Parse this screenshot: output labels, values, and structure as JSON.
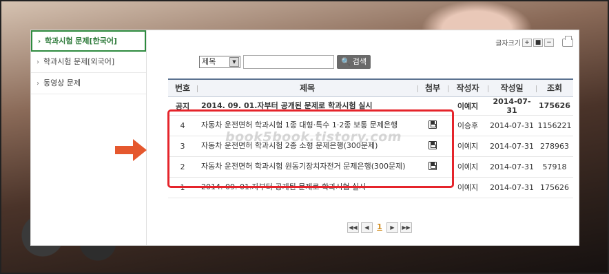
{
  "sidebar": {
    "items": [
      {
        "label": "학과시험 문제[한국어]",
        "active": true
      },
      {
        "label": "학과시험 문제[외국어]",
        "active": false
      },
      {
        "label": "동영상 문제",
        "active": false
      }
    ]
  },
  "font_size": {
    "label": "글자크기",
    "plus": "+",
    "reset": "■",
    "minus": "−"
  },
  "search": {
    "select_value": "제목",
    "button_label": "검색"
  },
  "table": {
    "headers": [
      "번호",
      "제목",
      "첨부",
      "작성자",
      "작성일",
      "조회"
    ],
    "rows": [
      {
        "no": "공지",
        "title": "2014. 09. 01.자부터 공개된 문제로 학과시험 실시",
        "attach": false,
        "author": "이예지",
        "date": "2014-07-31",
        "views": "175626",
        "notice": true
      },
      {
        "no": "4",
        "title": "자동차 운전면허 학과시험 1종 대형·특수 1·2종 보통 문제은행",
        "attach": true,
        "author": "이승후",
        "date": "2014-07-31",
        "views": "1156221",
        "notice": false
      },
      {
        "no": "3",
        "title": "자동차 운전면허 학과시험 2종 소형 문제은행(300문제)",
        "attach": true,
        "author": "이예지",
        "date": "2014-07-31",
        "views": "278963",
        "notice": false
      },
      {
        "no": "2",
        "title": "자동차 운전면허 학과시험 원동기장치자전거 문제은행(300문제)",
        "attach": true,
        "author": "이예지",
        "date": "2014-07-31",
        "views": "57918",
        "notice": false
      },
      {
        "no": "1",
        "title": "2014. 09. 01.자부터 공개된 문제로 학과시험 실시",
        "attach": false,
        "author": "이예지",
        "date": "2014-07-31",
        "views": "175626",
        "notice": false
      }
    ]
  },
  "pager": {
    "first": "◀◀",
    "prev": "◀",
    "current": "1",
    "next": "▶",
    "last": "▶▶"
  },
  "watermark": "book5book.tistory.com",
  "colors": {
    "highlight_box": "#e5242b",
    "arrow": "#e5582e",
    "active_tab": "#2d8a3e",
    "table_header_border": "#5b7290"
  }
}
